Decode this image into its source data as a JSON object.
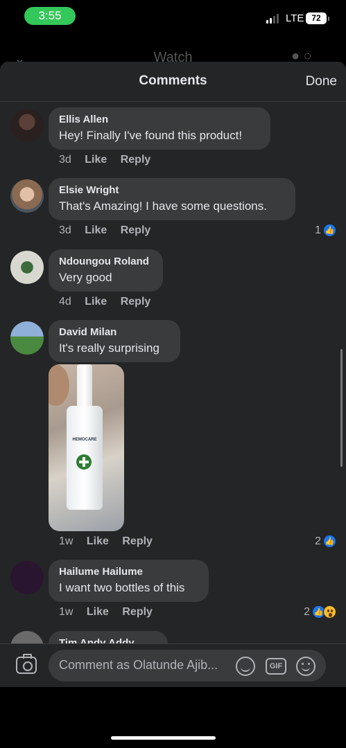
{
  "status": {
    "time": "3:55",
    "network": "LTE",
    "battery": "72"
  },
  "behind": {
    "title": "Watch"
  },
  "sheet": {
    "title": "Comments",
    "done_label": "Done"
  },
  "comments": [
    {
      "author": "Ellis Allen",
      "text": "Hey! Finally I've found this product!",
      "time": "3d",
      "like": "Like",
      "reply": "Reply"
    },
    {
      "author": "Elsie Wright",
      "text": "That's Amazing! I have some questions.",
      "time": "3d",
      "like": "Like",
      "reply": "Reply",
      "reactions": "1"
    },
    {
      "author": "Ndoungou Roland",
      "text": "Very good",
      "time": "4d",
      "like": "Like",
      "reply": "Reply"
    },
    {
      "author": "David Milan",
      "text": "It's really surprising",
      "time": "1w",
      "like": "Like",
      "reply": "Reply",
      "reactions": "2",
      "photo_label": "HEMOCARE"
    },
    {
      "author": "Hailume Hailume",
      "text": "I want two bottles of this",
      "time": "1w",
      "like": "Like",
      "reply": "Reply",
      "reactions": "2"
    },
    {
      "author": "Tim Andy Addy"
    }
  ],
  "composer": {
    "placeholder": "Comment as Olatunde Ajib...",
    "gif_label": "GIF"
  },
  "colors": {
    "sheet_bg": "#242526",
    "bubble_bg": "#3a3b3c",
    "like_blue": "#1877f2",
    "status_green": "#34c759"
  }
}
